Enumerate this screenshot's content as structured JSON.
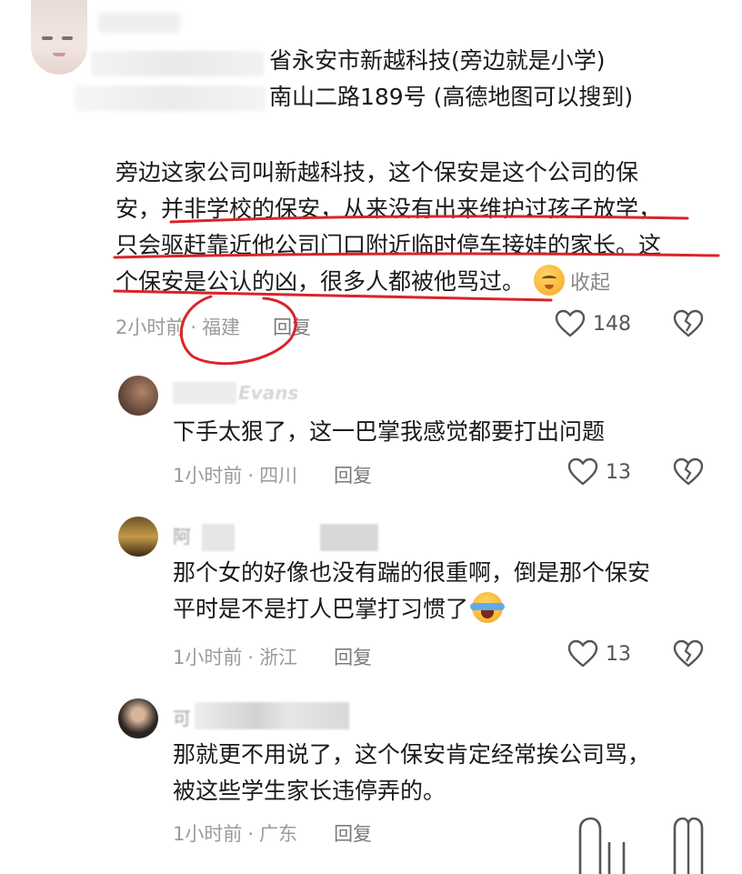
{
  "main_comment": {
    "address_line_1": "省永安市新越科技(旁边就是小学)",
    "address_line_2": "南山二路189号 (高德地图可以搜到)",
    "body_para_1": "旁边这家公司叫新越科技，这个保安是这个公司的保",
    "body_para_2": "安，并非学校的保安，从来没有出来维护过孩子放学，",
    "body_para_3": "只会驱赶靠近他公司门口附近临时停车接娃的家长。这",
    "body_para_4": "个保安是公认的凶，很多人都被他骂过。",
    "collapse_label": "收起",
    "time": "2小时前",
    "location": "福建",
    "reply_label": "回复",
    "likes": "148"
  },
  "replies": [
    {
      "name_visible": "Evans",
      "text_line_1": "下手太狠了，这一巴掌我感觉都要打出问题",
      "text_line_2": "",
      "time": "1小时前",
      "location": "四川",
      "reply_label": "回复",
      "likes": "13"
    },
    {
      "name_visible": "阿",
      "text_line_1": "那个女的好像也没有踹的很重啊，倒是那个保安",
      "text_line_2": "平时是不是打人巴掌打习惯了",
      "time": "1小时前",
      "location": "浙江",
      "reply_label": "回复",
      "likes": "13"
    },
    {
      "name_visible": "可",
      "text_line_1": "那就更不用说了，这个保安肯定经常挨公司骂，",
      "text_line_2": "被这些学生家长违停弄的。",
      "time": "1小时前",
      "location": "广东",
      "reply_label": "回复",
      "likes": ""
    }
  ],
  "colors": {
    "annotation_red": "#d9242a",
    "meta_gray": "#9b9b9b",
    "text": "#1a1a1a"
  },
  "icons": {
    "like": "heart-outline-icon",
    "dislike": "broken-heart-icon",
    "emoji_1": "smirk-face-emoji",
    "emoji_2": "crying-face-emoji"
  }
}
